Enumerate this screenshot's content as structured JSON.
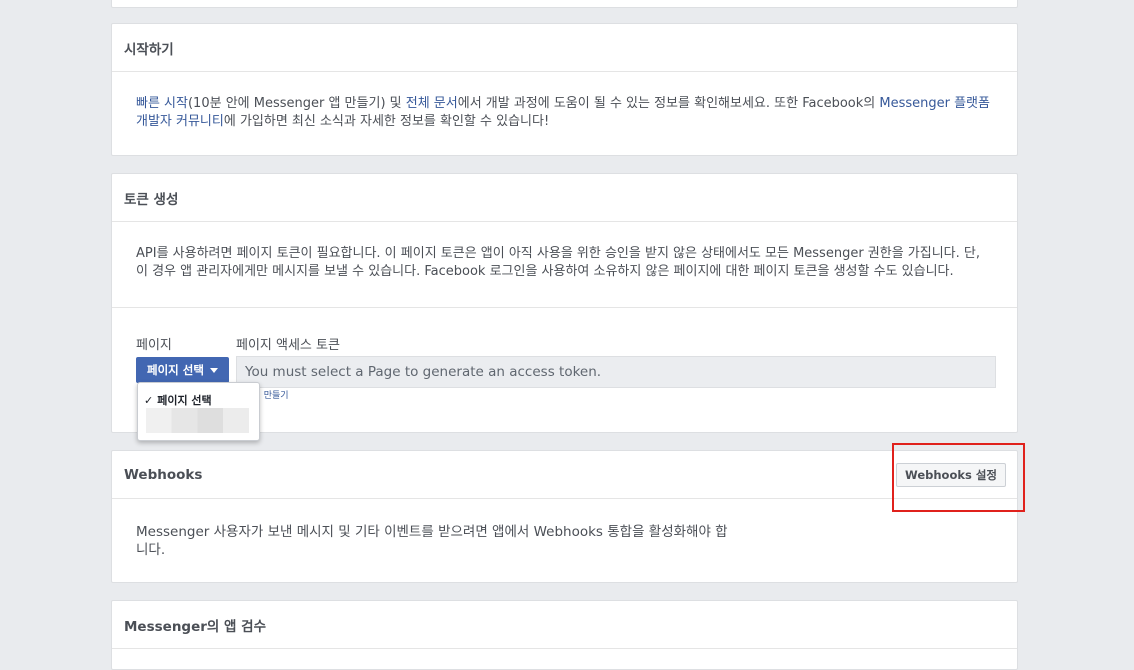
{
  "getting_started": {
    "title": "시작하기",
    "quickstart_link": "빠른 시작",
    "text1": "(10분 안에 Messenger 앱 만들기) 및 ",
    "docs_link": "전체 문서",
    "text2": "에서 개발 과정에 도움이 될 수 있는 정보를 확인해보세요. 또한 Facebook의 ",
    "community_link_1": "Messenger 플랫폼",
    "community_link_2": "개발자 커뮤니티",
    "text3": "에 가입하면 최신 소식과 자세한 정보를 확인할 수 있습니다!"
  },
  "token": {
    "title": "토큰 생성",
    "description_line1": "API를 사용하려면 페이지 토큰이 필요합니다. 이 페이지 토큰은 앱이 아직 사용을 위한 승인을 받지 않은 상태에서도 모든 Messenger 권한을 가집니다. 단,",
    "description_line2": "이 경우 앱 관리자에게만 메시지를 보낼 수 있습니다. Facebook 로그인을 사용하여 소유하지 않은 페이지에 대한 페이지 토큰을 생성할 수도 있습니다.",
    "page_label": "페이지",
    "access_token_label": "페이지 액세스 토큰",
    "select_button": "페이지 선택",
    "token_placeholder": "You must select a Page to generate an access token.",
    "create_page_link": "페이지 만들기",
    "dropdown_selected": "페이지 선택"
  },
  "webhooks": {
    "title": "Webhooks",
    "setup_button": "Webhooks 설정",
    "description_line1": "Messenger 사용자가 보낸 메시지 및 기타 이벤트를 받으려면 앱에서 Webhooks 통합을 활성화해야 합",
    "description_line2": "니다."
  },
  "review": {
    "title": "Messenger의 앱 검수"
  },
  "colors": {
    "background": "#e9ebee",
    "link": "#365899",
    "primary_button": "#4267b2",
    "highlight_box": "#e0211c"
  }
}
